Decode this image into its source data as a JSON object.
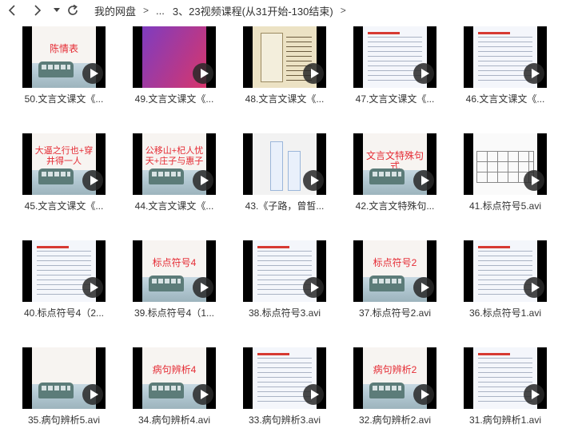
{
  "toolbar": {
    "back_icon": "chevron-left-icon",
    "forward_icon": "chevron-right-icon",
    "history_icon": "caret-down-icon",
    "refresh_icon": "refresh-icon"
  },
  "breadcrumb": {
    "root": "我的网盘",
    "ellipsis": "...",
    "current": "3、23视频课程(从31开始-130结束)",
    "separator": ">"
  },
  "files": [
    {
      "label": "50.文言文课文《...",
      "thumb_text": "陈情表",
      "style": "slide"
    },
    {
      "label": "49.文言文课文《...",
      "thumb_text": "",
      "style": "purple"
    },
    {
      "label": "48.文言文课文《...",
      "thumb_text": "",
      "style": "book"
    },
    {
      "label": "47.文言文课文《...",
      "thumb_text": "",
      "style": "doc"
    },
    {
      "label": "46.文言文课文《...",
      "thumb_text": "",
      "style": "doc"
    },
    {
      "label": "45.文言文课文《...",
      "thumb_text": "大逼之行也+穿井得一人",
      "style": "slide"
    },
    {
      "label": "44.文言文课文《...",
      "thumb_text": "公移山+杞人忧天+庄子与惠子",
      "style": "slide"
    },
    {
      "label": "43.《子路，曾皙...",
      "thumb_text": "",
      "style": "chart"
    },
    {
      "label": "42.文言文特殊句...",
      "thumb_text": "文言文特殊句式",
      "style": "slide"
    },
    {
      "label": "41.标点符号5.avi",
      "thumb_text": "",
      "style": "table"
    },
    {
      "label": "40.标点符号4（2...",
      "thumb_text": "",
      "style": "doc"
    },
    {
      "label": "39.标点符号4（1...",
      "thumb_text": "标点符号4",
      "style": "slide"
    },
    {
      "label": "38.标点符号3.avi",
      "thumb_text": "",
      "style": "doc"
    },
    {
      "label": "37.标点符号2.avi",
      "thumb_text": "标点符号2",
      "style": "slide"
    },
    {
      "label": "36.标点符号1.avi",
      "thumb_text": "",
      "style": "doc"
    },
    {
      "label": "35.病句辨析5.avi",
      "thumb_text": "",
      "style": "slide"
    },
    {
      "label": "34.病句辨析4.avi",
      "thumb_text": "病句辨析4",
      "style": "slide"
    },
    {
      "label": "33.病句辨析3.avi",
      "thumb_text": "",
      "style": "doc"
    },
    {
      "label": "32.病句辨析2.avi",
      "thumb_text": "病句辨析2",
      "style": "slide"
    },
    {
      "label": "31.病句辨析1.avi",
      "thumb_text": "",
      "style": "doc"
    }
  ],
  "colors": {
    "accent_red": "#e52b34",
    "play_button": "#282828"
  }
}
